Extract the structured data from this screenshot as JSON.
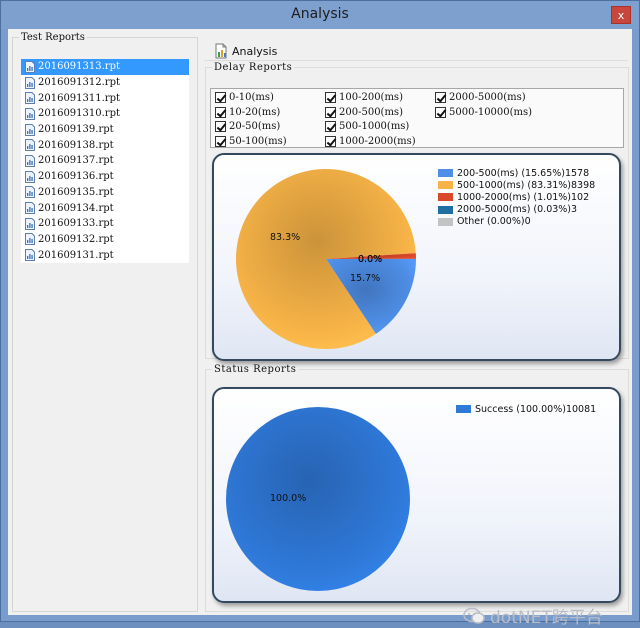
{
  "window": {
    "title": "Analysis",
    "close_glyph": "x"
  },
  "test_reports": {
    "legend": "Test Reports",
    "items": [
      "2016091313.rpt",
      "2016091312.rpt",
      "2016091311.rpt",
      "2016091310.rpt",
      "201609139.rpt",
      "201609138.rpt",
      "201609137.rpt",
      "201609136.rpt",
      "201609135.rpt",
      "201609134.rpt",
      "201609133.rpt",
      "201609132.rpt",
      "201609131.rpt"
    ],
    "selected_index": 0
  },
  "toolbar": {
    "analysis_label": "Analysis",
    "analysis_icon": "chart-document-icon"
  },
  "delay_reports": {
    "legend": "Delay  Reports",
    "checkboxes": [
      {
        "label": "0-10(ms)",
        "checked": true
      },
      {
        "label": "10-20(ms)",
        "checked": true
      },
      {
        "label": "20-50(ms)",
        "checked": true
      },
      {
        "label": "50-100(ms)",
        "checked": true
      },
      {
        "label": "100-200(ms)",
        "checked": true
      },
      {
        "label": "200-500(ms)",
        "checked": true
      },
      {
        "label": "500-1000(ms)",
        "checked": true
      },
      {
        "label": "1000-2000(ms)",
        "checked": true
      },
      {
        "label": "2000-5000(ms)",
        "checked": true
      },
      {
        "label": "5000-10000(ms)",
        "checked": true
      }
    ]
  },
  "status_reports": {
    "legend": "Status Reports"
  },
  "chart_data": [
    {
      "type": "pie",
      "categories": [
        "200-500(ms)",
        "500-1000(ms)",
        "1000-2000(ms)",
        "2000-5000(ms)",
        "Other"
      ],
      "values": [
        1578,
        8398,
        102,
        3,
        0
      ],
      "percents": [
        15.65,
        83.31,
        1.01,
        0.03,
        0.0
      ],
      "colors": [
        "#4f8fe8",
        "#f7b347",
        "#d9482b",
        "#1f6fa3",
        "#c3c3c3"
      ],
      "legend_labels": [
        "200-500(ms) (15.65%)1578",
        "500-1000(ms) (83.31%)8398",
        "1000-2000(ms) (1.01%)102",
        "2000-5000(ms) (0.03%)3",
        "Other (0.00%)0"
      ],
      "slice_labels": [
        "15.7%",
        "83.3%",
        "0.0%",
        "0.0%",
        "0.0%"
      ],
      "legend_position": "top-right"
    },
    {
      "type": "pie",
      "categories": [
        "Success"
      ],
      "values": [
        10081
      ],
      "percents": [
        100.0
      ],
      "colors": [
        "#2f79d9"
      ],
      "legend_labels": [
        "Success (100.00%)10081"
      ],
      "slice_labels": [
        "100.0%"
      ],
      "legend_position": "top-right"
    }
  ],
  "watermark": {
    "text": "dotNET跨平台",
    "icon": "wechat-icon"
  }
}
